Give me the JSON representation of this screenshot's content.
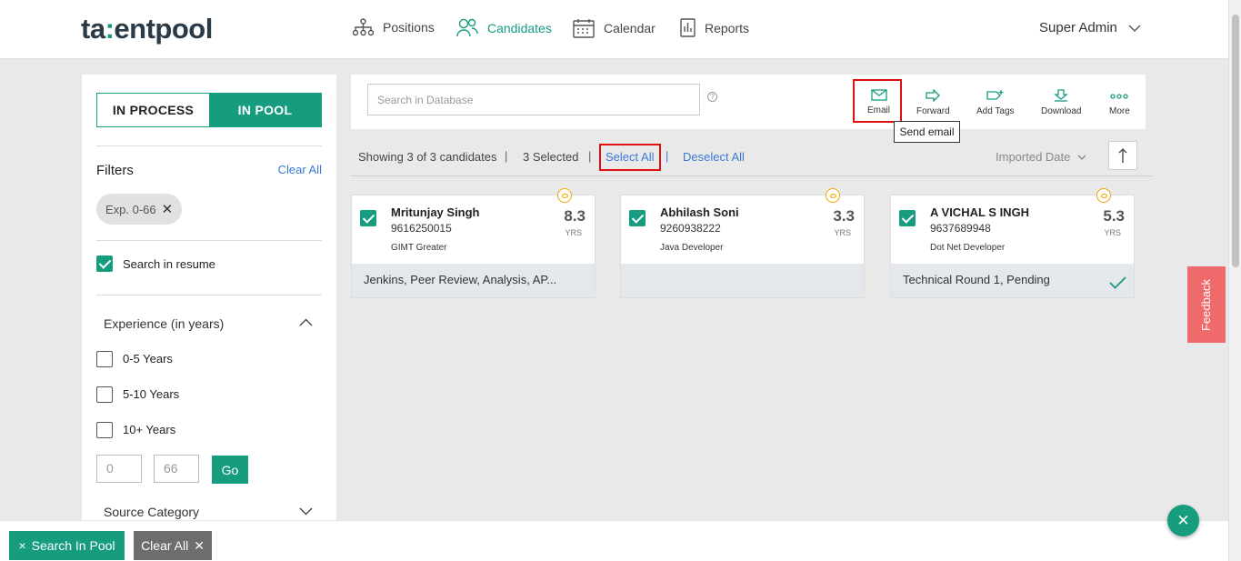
{
  "header": {
    "logo": "talentpool",
    "nav": [
      {
        "label": "Positions",
        "icon": "hierarchy-icon"
      },
      {
        "label": "Candidates",
        "icon": "users-icon",
        "active": true
      },
      {
        "label": "Calendar",
        "icon": "calendar-icon"
      },
      {
        "label": "Reports",
        "icon": "report-icon"
      }
    ],
    "user": "Super Admin"
  },
  "sidebar": {
    "toggle": {
      "in_process": "IN PROCESS",
      "in_pool": "IN POOL",
      "selected": "IN POOL"
    },
    "filters_title": "Filters",
    "clear_all": "Clear All",
    "chip": "Exp. 0-66",
    "search_resume": {
      "label": "Search in resume",
      "checked": true
    },
    "experience": {
      "title": "Experience (in years)",
      "options": [
        {
          "label": "0-5 Years",
          "checked": false
        },
        {
          "label": "5-10 Years",
          "checked": false
        },
        {
          "label": "10+ Years",
          "checked": false
        }
      ],
      "min": "0",
      "max": "66",
      "go": "Go"
    },
    "source_category": "Source Category"
  },
  "toolbar": {
    "search_placeholder": "Search in Database",
    "help": "?",
    "actions": {
      "email": "Email",
      "forward": "Forward",
      "add_tags": "Add Tags",
      "download": "Download",
      "more": "More"
    },
    "tooltip": "Send email"
  },
  "results": {
    "showing": "Showing 3 of 3 candidates",
    "selected": "3 Selected",
    "select_all": "Select All",
    "deselect_all": "Deselect All",
    "sort": "Imported Date"
  },
  "candidates": [
    {
      "name": "Mritunjay Singh",
      "phone": "9616250015",
      "role": "GIMT Greater",
      "exp": "8.3",
      "unit": "YRS",
      "footer": "Jenkins, Peer Review, Analysis, AP...",
      "checked": true
    },
    {
      "name": "Abhilash Soni",
      "phone": "9260938222",
      "role": "Java Developer",
      "exp": "3.3",
      "unit": "YRS",
      "footer": "",
      "checked": true
    },
    {
      "name": "A VICHAL S INGH",
      "phone": "9637689948",
      "role": "Dot Net Developer",
      "exp": "5.3",
      "unit": "YRS",
      "footer": "Technical Round 1, Pending",
      "checked": true
    }
  ],
  "feedback": "Feedback",
  "bottom": {
    "search_in_pool": "Search In Pool",
    "clear_all": "Clear All"
  },
  "colors": {
    "primary": "#169c7f",
    "link": "#3a7bd5",
    "highlight": "#e01010",
    "feedback": "#ef6a6a",
    "eye": "#f0a500"
  }
}
